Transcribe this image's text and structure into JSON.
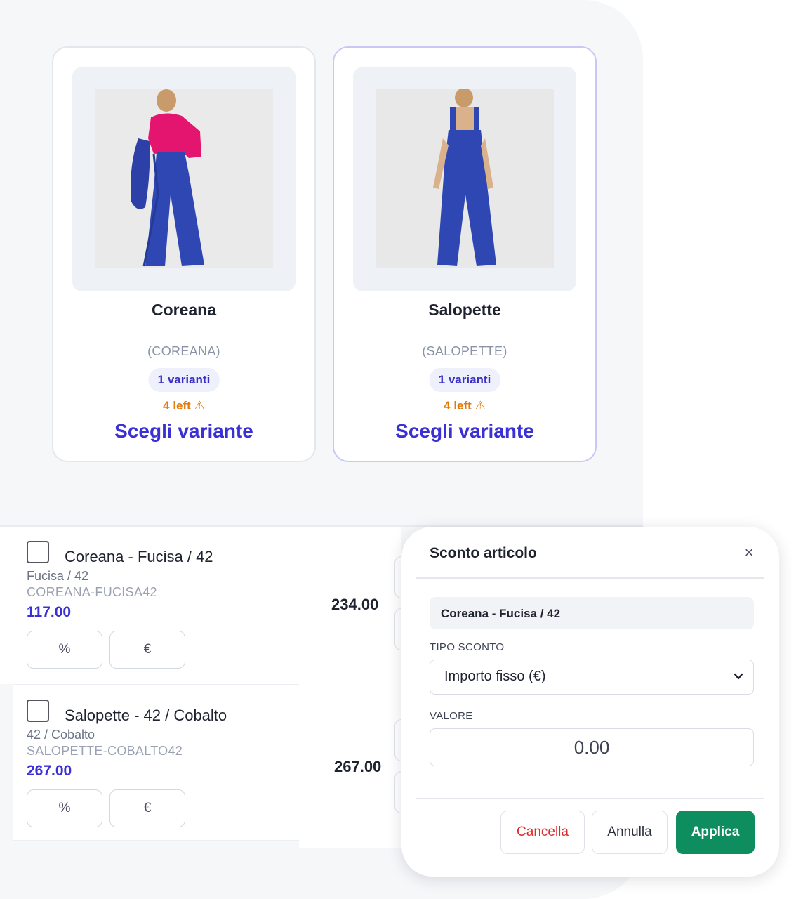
{
  "products": [
    {
      "name": "Coreana",
      "code": "(COREANA)",
      "variants_badge": "1 varianti",
      "stock_label": "4 left",
      "stock_icon": "warning-icon",
      "action_label": "Scegli variante",
      "selected": false
    },
    {
      "name": "Salopette",
      "code": "(SALOPETTE)",
      "variants_badge": "1 varianti",
      "stock_label": "4 left",
      "stock_icon": "warning-icon",
      "action_label": "Scegli variante",
      "selected": true
    }
  ],
  "order_lines": [
    {
      "title": "Coreana - Fucisa / 42",
      "variant": "Fucisa / 42",
      "sku": "COREANA-FUCISA42",
      "unit_price": "117.00",
      "line_total": "234.00",
      "percent_label": "%",
      "euro_label": "€"
    },
    {
      "title": "Salopette - 42 / Cobalto",
      "variant": "42 / Cobalto",
      "sku": "SALOPETTE-COBALTO42",
      "unit_price": "267.00",
      "line_total": "267.00",
      "percent_label": "%",
      "euro_label": "€"
    }
  ],
  "discount_modal": {
    "title": "Sconto articolo",
    "close_icon": "close-icon",
    "item_name": "Coreana - Fucisa / 42",
    "type_label": "TIPO SCONTO",
    "type_value": "Importo fisso (€)",
    "value_label": "VALORE",
    "value": "0.00",
    "cancel_label": "Cancella",
    "dismiss_label": "Annulla",
    "apply_label": "Applica"
  },
  "colors": {
    "accent": "#3b2fd6",
    "warning": "#e07a0c",
    "apply": "#0e8e5e",
    "danger": "#dc2a2a"
  }
}
